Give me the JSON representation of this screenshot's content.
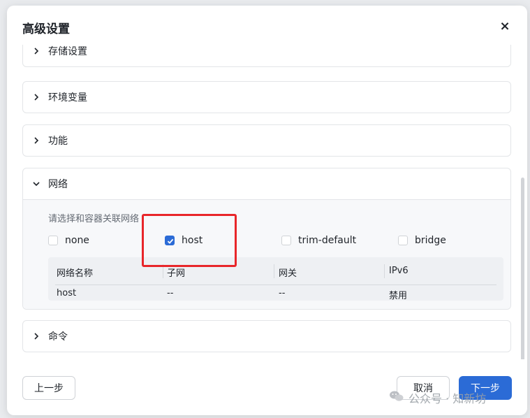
{
  "dialog": {
    "title": "高级设置",
    "close_glyph": "×"
  },
  "sections": {
    "storage": {
      "title": "存储设置",
      "expanded": false
    },
    "env": {
      "title": "环境变量",
      "expanded": false
    },
    "features": {
      "title": "功能",
      "expanded": false
    },
    "network": {
      "title": "网络",
      "expanded": true,
      "hint": "请选择和容器关联网络",
      "options": [
        {
          "label": "none",
          "checked": false
        },
        {
          "label": "host",
          "checked": true
        },
        {
          "label": "trim-default",
          "checked": false
        },
        {
          "label": "bridge",
          "checked": false
        }
      ],
      "table": {
        "headers": [
          "网络名称",
          "子网",
          "网关",
          "IPv6"
        ],
        "rows": [
          [
            "host",
            "--",
            "--",
            "禁用"
          ]
        ]
      }
    },
    "command": {
      "title": "命令",
      "expanded": false
    }
  },
  "footer": {
    "prev_label": "上一步",
    "cancel_label": "取消",
    "next_label": "下一步"
  },
  "watermark": {
    "text": "公众号 · 知新坊",
    "icon": "wechat-icon"
  },
  "colors": {
    "primary": "#2b6bd6",
    "highlight": "#e8262a"
  }
}
